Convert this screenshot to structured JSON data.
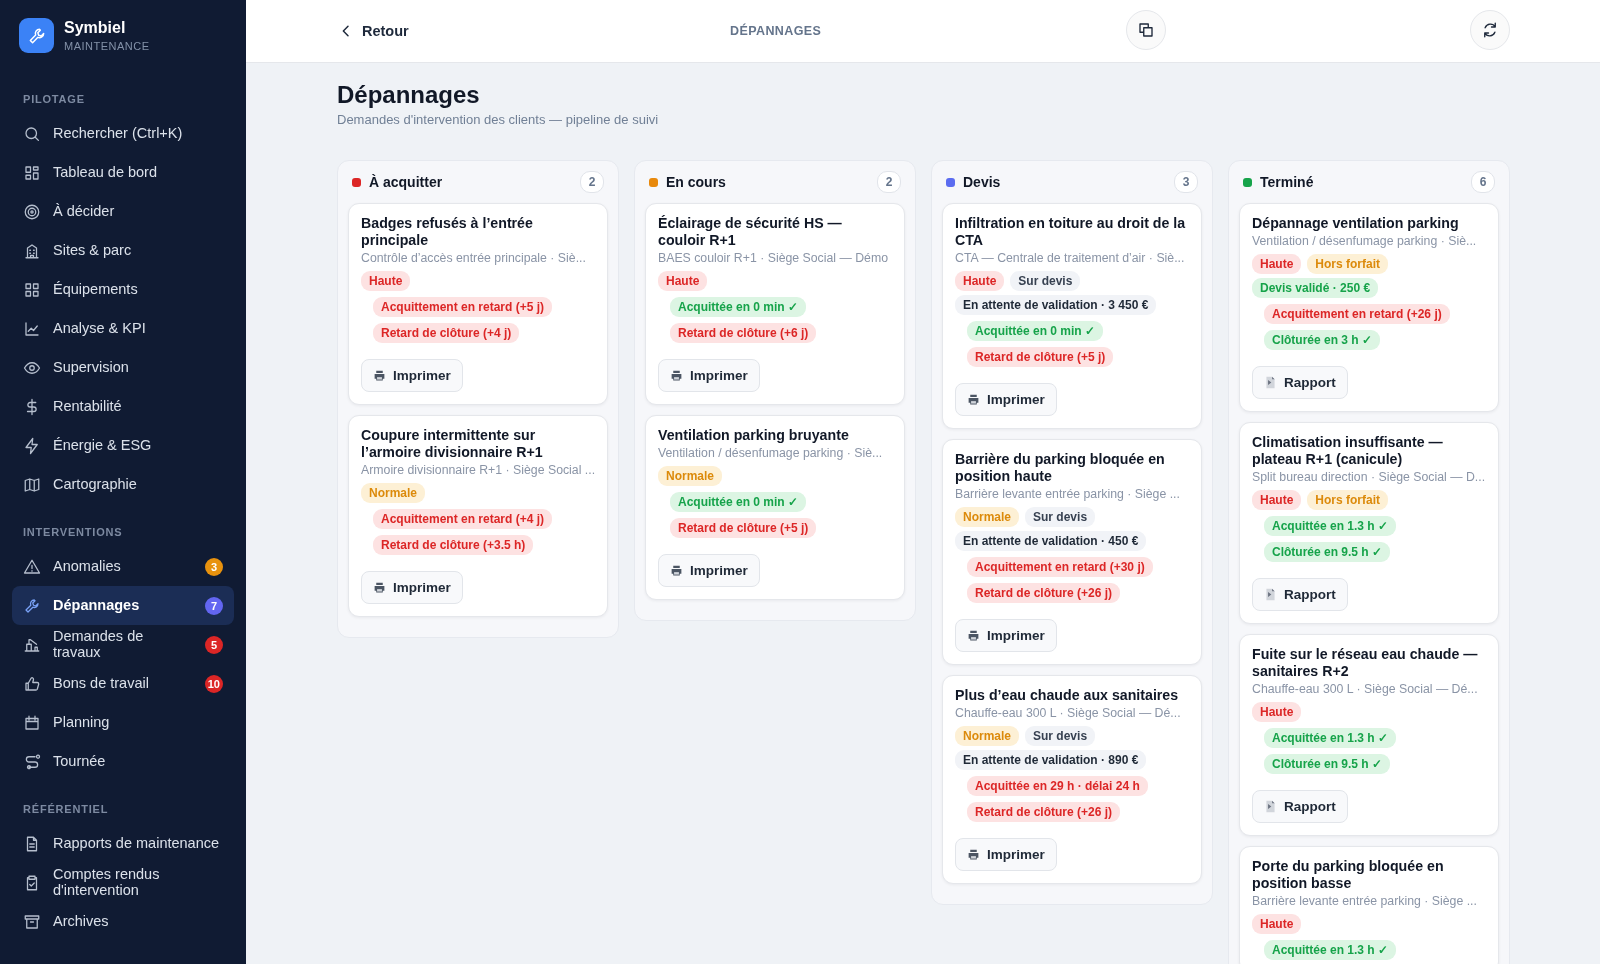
{
  "app": {
    "name": "Symbiel",
    "subtitle": "MAINTENANCE"
  },
  "sidebar": {
    "sections": [
      {
        "title": "PILOTAGE",
        "items": [
          {
            "label": "Rechercher (Ctrl+K)",
            "kind": "search",
            "selected": false
          },
          {
            "label": "Tableau de bord",
            "kind": "dashboard",
            "selected": false
          },
          {
            "label": "À décider",
            "kind": "target",
            "selected": false
          },
          {
            "label": "Sites & parc",
            "kind": "building",
            "selected": false
          },
          {
            "label": "Équipements",
            "kind": "grid",
            "selected": false
          },
          {
            "label": "Analyse & KPI",
            "kind": "chart",
            "selected": false
          },
          {
            "label": "Supervision",
            "kind": "eye",
            "selected": false
          },
          {
            "label": "Rentabilité",
            "kind": "dollar",
            "selected": false
          },
          {
            "label": "Énergie & ESG",
            "kind": "bolt",
            "selected": false
          },
          {
            "label": "Cartographie",
            "kind": "map",
            "selected": false
          }
        ]
      },
      {
        "title": "INTERVENTIONS",
        "items": [
          {
            "label": "Anomalies",
            "kind": "warning",
            "selected": false,
            "badge": "3",
            "color": "#e8920e"
          },
          {
            "label": "Dépannages",
            "kind": "wrench",
            "selected": true,
            "badge": "7",
            "color": "#6366f1"
          },
          {
            "label": "Demandes de travaux",
            "kind": "crane",
            "selected": false,
            "badge": "5",
            "color": "#dc2626"
          },
          {
            "label": "Bons de travail",
            "kind": "thumb",
            "selected": false,
            "badge": "10",
            "color": "#dc2626"
          },
          {
            "label": "Planning",
            "kind": "calendar",
            "selected": false
          },
          {
            "label": "Tournée",
            "kind": "route",
            "selected": false
          }
        ]
      },
      {
        "title": "RÉFÉRENTIEL",
        "items": [
          {
            "label": "Rapports de maintenance",
            "kind": "file",
            "selected": false
          },
          {
            "label": "Comptes rendus d'intervention",
            "kind": "clipboard",
            "selected": false
          },
          {
            "label": "Archives",
            "kind": "archive",
            "selected": false
          }
        ]
      }
    ]
  },
  "topbar": {
    "back": "Retour",
    "title": "DÉPANNAGES"
  },
  "page": {
    "title": "Dépannages",
    "subtitle": "Demandes d'intervention des clients — pipeline de suivi"
  },
  "columns": [
    {
      "title": "À acquitter",
      "count": "2",
      "color": "#dc2626",
      "cards": [
        {
          "title": "Badges refusés à l’entrée principale",
          "subtitle": "Contrôle d’accès entrée principale · Siè...",
          "priority": {
            "label": "Haute",
            "kind": "high"
          },
          "checks": [
            {
              "label": "Acquittement en retard (+5 j)",
              "ok": false
            },
            {
              "label": "Retard de clôture (+4 j)",
              "ok": false
            }
          ],
          "button": {
            "label": "Imprimer",
            "kind": "print"
          }
        },
        {
          "title": "Coupure intermittente sur l’armoire divisionnaire R+1",
          "subtitle": "Armoire divisionnaire R+1 · Siège Social ...",
          "priority": {
            "label": "Normale",
            "kind": "normal"
          },
          "checks": [
            {
              "label": "Acquittement en retard (+4 j)",
              "ok": false
            },
            {
              "label": "Retard de clôture (+3.5 h)",
              "ok": false
            }
          ],
          "button": {
            "label": "Imprimer",
            "kind": "print"
          }
        }
      ]
    },
    {
      "title": "En cours",
      "count": "2",
      "color": "#e8890c",
      "cards": [
        {
          "title": "Éclairage de sécurité HS — couloir R+1",
          "subtitle": "BAES couloir R+1 · Siège Social — Démo",
          "priority": {
            "label": "Haute",
            "kind": "high"
          },
          "checks": [
            {
              "label": "Acquittée en 0 min ✓",
              "ok": true
            },
            {
              "label": "Retard de clôture (+6 j)",
              "ok": false
            }
          ],
          "button": {
            "label": "Imprimer",
            "kind": "print"
          }
        },
        {
          "title": "Ventilation parking bruyante",
          "subtitle": "Ventilation / désenfumage parking · Siè...",
          "priority": {
            "label": "Normale",
            "kind": "normal"
          },
          "checks": [
            {
              "label": "Acquittée en 0 min ✓",
              "ok": true
            },
            {
              "label": "Retard de clôture (+5 j)",
              "ok": false
            }
          ],
          "button": {
            "label": "Imprimer",
            "kind": "print"
          }
        }
      ]
    },
    {
      "title": "Devis",
      "count": "3",
      "color": "#5b6cf0",
      "cards": [
        {
          "title": "Infiltration en toiture au droit de la CTA",
          "subtitle": "CTA — Centrale de traitement d’air · Siè...",
          "priority": {
            "label": "Haute",
            "kind": "high"
          },
          "tag": {
            "label": "Sur devis",
            "kind": "quote"
          },
          "quote": {
            "label": "En attente de validation · 3 450 €",
            "validated": false
          },
          "checks": [
            {
              "label": "Acquittée en 0 min ✓",
              "ok": true
            },
            {
              "label": "Retard de clôture (+5 j)",
              "ok": false
            }
          ],
          "button": {
            "label": "Imprimer",
            "kind": "print"
          }
        },
        {
          "title": "Barrière du parking bloquée en position haute",
          "subtitle": "Barrière levante entrée parking · Siège ...",
          "priority": {
            "label": "Normale",
            "kind": "normal"
          },
          "tag": {
            "label": "Sur devis",
            "kind": "quote"
          },
          "quote": {
            "label": "En attente de validation · 450 €",
            "validated": false
          },
          "checks": [
            {
              "label": "Acquittement en retard (+30 j)",
              "ok": false
            },
            {
              "label": "Retard de clôture (+26 j)",
              "ok": false
            }
          ],
          "button": {
            "label": "Imprimer",
            "kind": "print"
          }
        },
        {
          "title": "Plus d’eau chaude aux sanitaires",
          "subtitle": "Chauffe-eau 300 L · Siège Social — Dé...",
          "priority": {
            "label": "Normale",
            "kind": "normal"
          },
          "tag": {
            "label": "Sur devis",
            "kind": "quote"
          },
          "quote": {
            "label": "En attente de validation · 890 €",
            "validated": false
          },
          "checks": [
            {
              "label": "Acquittée en 29 h · délai 24 h",
              "ok": false
            },
            {
              "label": "Retard de clôture (+26 j)",
              "ok": false
            }
          ],
          "button": {
            "label": "Imprimer",
            "kind": "print"
          }
        }
      ]
    },
    {
      "title": "Terminé",
      "count": "6",
      "color": "#16a34a",
      "cards": [
        {
          "title": "Dépannage ventilation parking",
          "subtitle": "Ventilation / désenfumage parking · Siè...",
          "priority": {
            "label": "Haute",
            "kind": "high"
          },
          "tag": {
            "label": "Hors forfait",
            "kind": "extra"
          },
          "quote": {
            "label": "Devis validé · 250 €",
            "validated": true
          },
          "checks": [
            {
              "label": "Acquittement en retard (+26 j)",
              "ok": false
            },
            {
              "label": "Clôturée en 3 h ✓",
              "ok": true
            }
          ],
          "button": {
            "label": "Rapport",
            "kind": "report"
          }
        },
        {
          "title": "Climatisation insuffisante — plateau R+1 (canicule)",
          "subtitle": "Split bureau direction · Siège Social — D...",
          "priority": {
            "label": "Haute",
            "kind": "high"
          },
          "tag": {
            "label": "Hors forfait",
            "kind": "extra"
          },
          "checks": [
            {
              "label": "Acquittée en 1.3 h ✓",
              "ok": true
            },
            {
              "label": "Clôturée en 9.5 h ✓",
              "ok": true
            }
          ],
          "button": {
            "label": "Rapport",
            "kind": "report"
          }
        },
        {
          "title": "Fuite sur le réseau eau chaude — sanitaires R+2",
          "subtitle": "Chauffe-eau 300 L · Siège Social — Dé...",
          "priority": {
            "label": "Haute",
            "kind": "high"
          },
          "checks": [
            {
              "label": "Acquittée en 1.3 h ✓",
              "ok": true
            },
            {
              "label": "Clôturée en 9.5 h ✓",
              "ok": true
            }
          ],
          "button": {
            "label": "Rapport",
            "kind": "report"
          }
        },
        {
          "title": "Porte du parking bloquée en position basse",
          "subtitle": "Barrière levante entrée parking · Siège ...",
          "priority": {
            "label": "Haute",
            "kind": "high"
          },
          "checks": [
            {
              "label": "Acquittée en 1.3 h ✓",
              "ok": true
            }
          ]
        }
      ]
    }
  ]
}
